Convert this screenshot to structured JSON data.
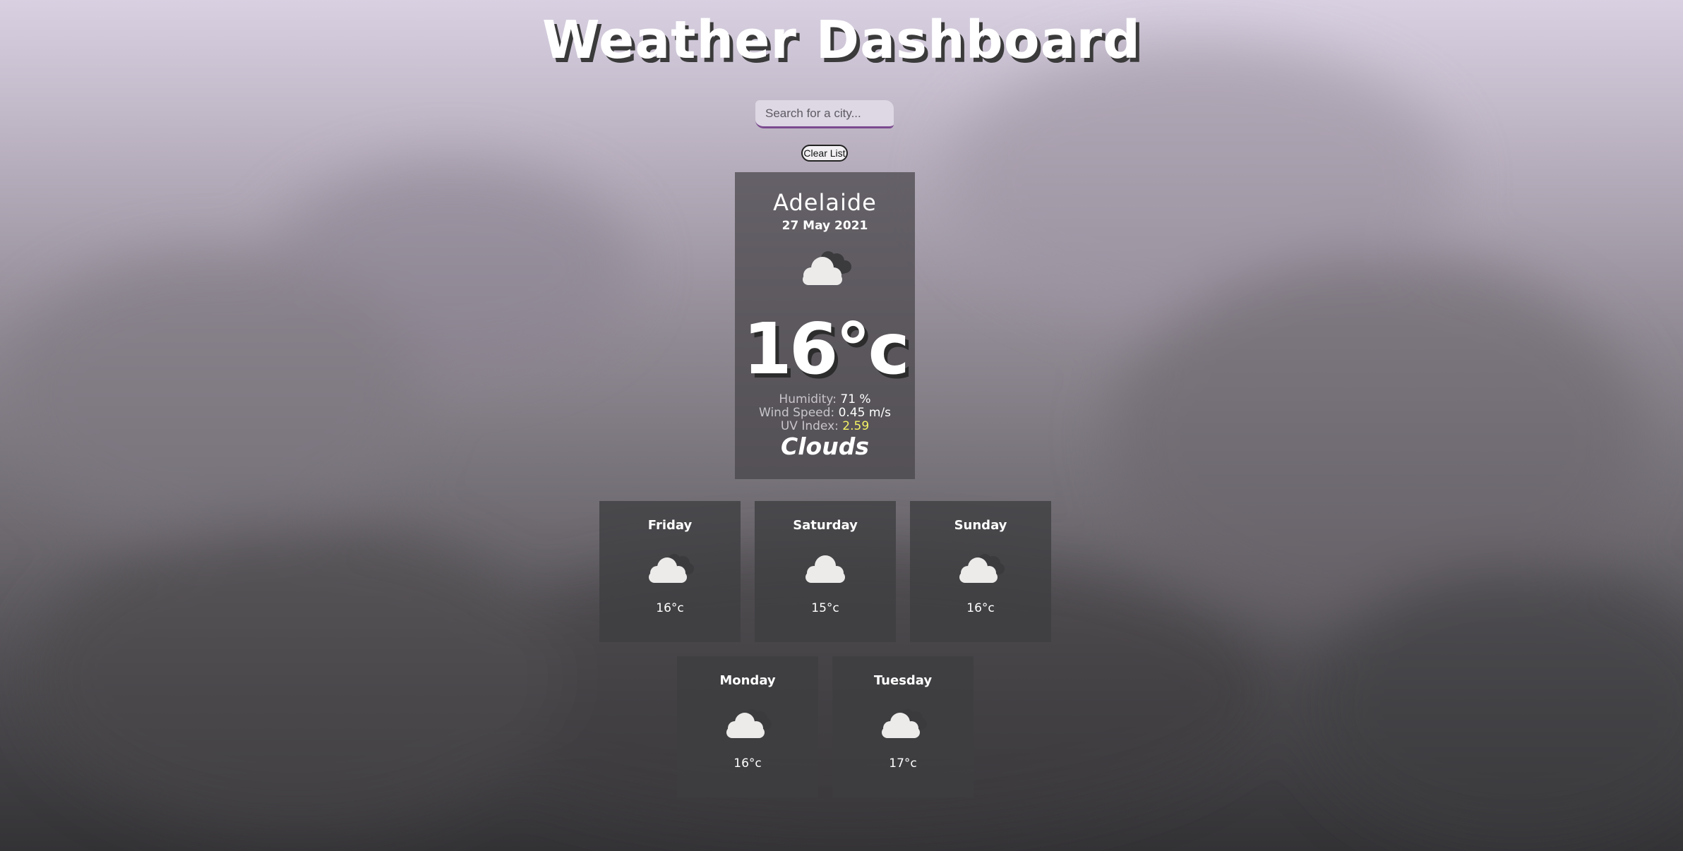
{
  "header": {
    "title": "Weather Dashboard"
  },
  "search": {
    "placeholder": "Search for a city...",
    "value": ""
  },
  "buttons": {
    "clear_label": "Clear List"
  },
  "current": {
    "city": "Adelaide",
    "date": "27 May 2021",
    "icon": "clouds-icon",
    "temperature": "16°c",
    "humidity_label": "Humidity:",
    "humidity_value": "71 %",
    "wind_label": "Wind Speed:",
    "wind_value": "0.45 m/s",
    "uv_label": "UV Index:",
    "uv_value": "2.59",
    "description": "Clouds"
  },
  "forecast": [
    {
      "day": "Friday",
      "icon": "clouds-icon",
      "temp": "16°c"
    },
    {
      "day": "Saturday",
      "icon": "cloud-icon",
      "temp": "15°c"
    },
    {
      "day": "Sunday",
      "icon": "clouds-icon",
      "temp": "16°c"
    },
    {
      "day": "Monday",
      "icon": "clouds-icon",
      "temp": "16°c"
    },
    {
      "day": "Tuesday",
      "icon": "clouds-icon",
      "temp": "17°c"
    }
  ],
  "colors": {
    "search_underline": "#7b4a8f",
    "uv_highlight": "#f4f264",
    "card_bg": "#464448",
    "title_shadow": "#3a3a3a"
  }
}
